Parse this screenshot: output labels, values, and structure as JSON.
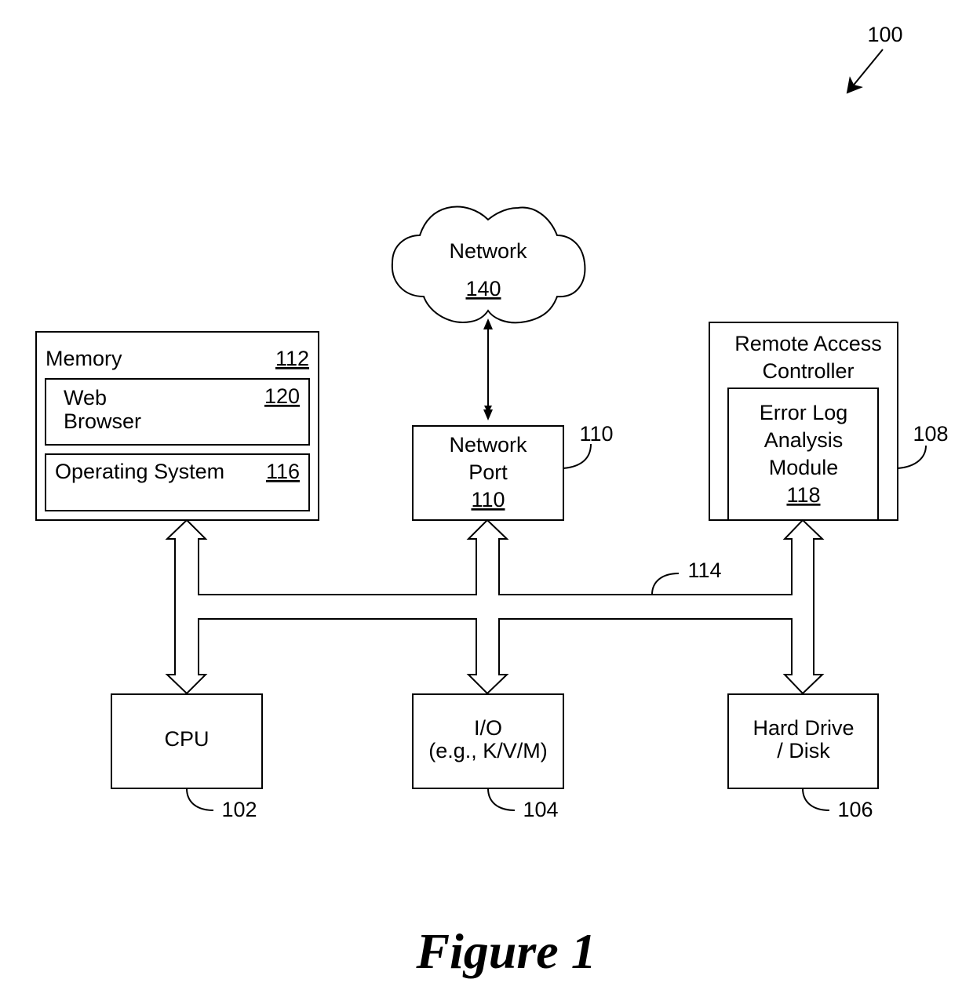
{
  "figure": {
    "reference": "100",
    "caption": "Figure 1"
  },
  "network": {
    "label": "Network",
    "ref": "140"
  },
  "memory": {
    "label": "Memory",
    "ref": "112",
    "web_browser": {
      "line1": "Web",
      "line2": "Browser",
      "ref": "120"
    },
    "operating_system": {
      "label": "Operating System",
      "ref": "116"
    }
  },
  "network_port": {
    "line1": "Network",
    "line2": "Port",
    "ref": "110",
    "callout": "110"
  },
  "remote_access_controller": {
    "line1": "Remote Access",
    "line2": "Controller",
    "callout": "108",
    "error_log_module": {
      "line1": "Error Log",
      "line2": "Analysis",
      "line3": "Module",
      "ref": "118"
    }
  },
  "bus": {
    "callout": "114"
  },
  "cpu": {
    "label": "CPU",
    "callout": "102"
  },
  "io": {
    "line1": "I/O",
    "line2": "(e.g., K/V/M)",
    "callout": "104"
  },
  "hard_drive": {
    "line1": "Hard Drive",
    "line2": "/ Disk",
    "callout": "106"
  }
}
